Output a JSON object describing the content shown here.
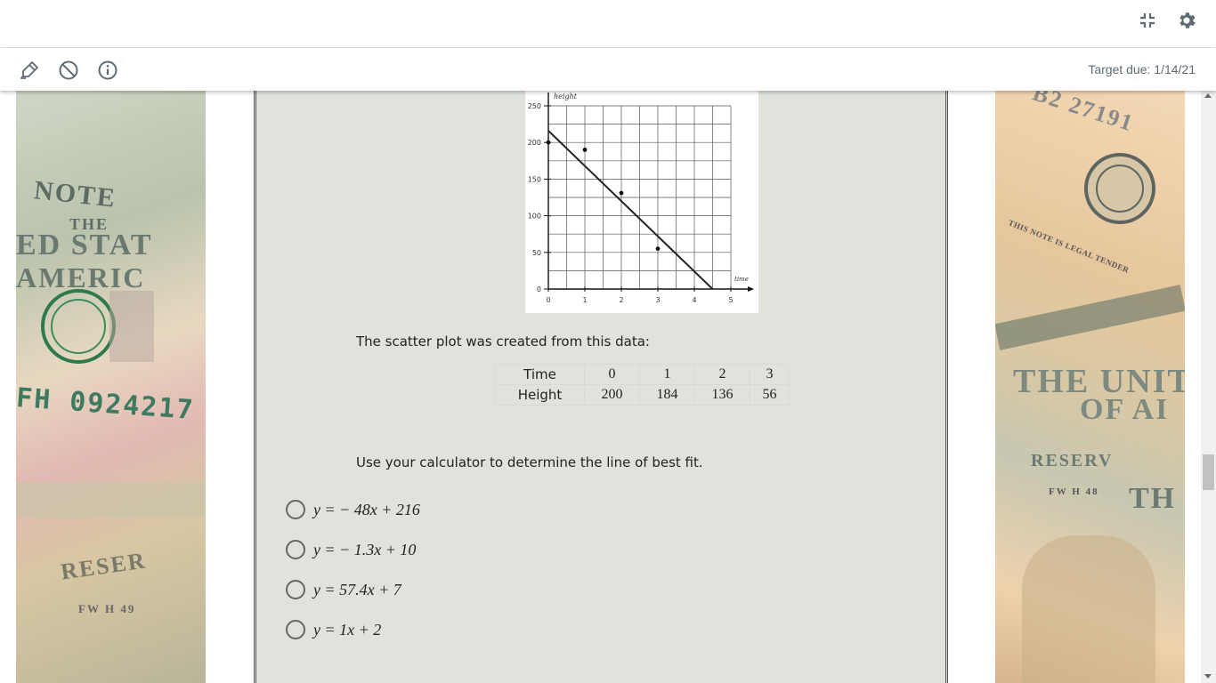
{
  "header": {
    "collapse_icon": "collapse-arrows-icon",
    "settings_icon": "gear-icon"
  },
  "toolbar": {
    "tools": [
      "highlighter-icon",
      "eliminate-icon",
      "info-icon"
    ],
    "target_due": "Target due: 1/14/21"
  },
  "question": {
    "caption": "The scatter plot was created from this data:",
    "table": {
      "rows": [
        {
          "label": "Time",
          "values": [
            "0",
            "1",
            "2",
            "3"
          ]
        },
        {
          "label": "Height",
          "values": [
            "200",
            "184",
            "136",
            "56"
          ]
        }
      ]
    },
    "instruction": "Use your calculator to determine the line of best fit.",
    "choices": [
      "y =  − 48x + 216",
      "y =  − 1.3x + 10",
      "y = 57.4x + 7",
      "y = 1x + 2"
    ]
  },
  "chart_data": {
    "type": "scatter",
    "xlabel": "time",
    "ylabel": "height",
    "xlim": [
      0,
      5
    ],
    "ylim": [
      0,
      250
    ],
    "x_ticks": [
      "0",
      "1",
      "2",
      "3",
      "4",
      "5"
    ],
    "y_ticks": [
      "0",
      "50",
      "100",
      "150",
      "200",
      "250"
    ],
    "grid": true,
    "points": [
      {
        "x": 0,
        "y": 200
      },
      {
        "x": 1,
        "y": 190
      },
      {
        "x": 2,
        "y": 131
      },
      {
        "x": 3,
        "y": 55
      }
    ],
    "trend_line": {
      "slope": -48,
      "intercept": 216
    }
  },
  "decor": {
    "left_bill_text": [
      "NOTE",
      "THE",
      "ED STAT",
      "AMERIC",
      "FH 0924217",
      "RESER",
      "FW H 49"
    ],
    "right_bill_text": [
      "B2 27191",
      "THIS NOTE IS LEGAL TENDER",
      "THE UNIT",
      "OF AI",
      "RESERV",
      "FW H 48",
      "TH"
    ]
  },
  "colors": {
    "panel_bg": "#e0e3dc",
    "text": "#222222",
    "icon": "#5f6b73"
  }
}
